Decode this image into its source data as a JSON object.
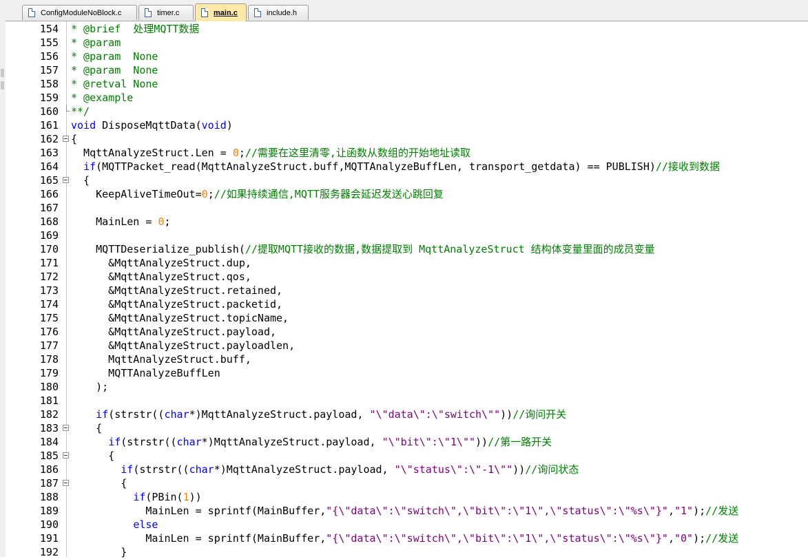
{
  "tabs": [
    {
      "label": "ConfigModuleNoBlock.c",
      "active": false,
      "icon": "c-file-icon"
    },
    {
      "label": "timer.c",
      "active": false,
      "icon": "c-file-icon"
    },
    {
      "label": "main.c",
      "active": true,
      "icon": "c-file-icon"
    },
    {
      "label": "include.h",
      "active": false,
      "icon": "header-file-icon"
    }
  ],
  "colors": {
    "keyword": "#0000ff",
    "comment": "#008000",
    "number": "#ff8000",
    "string": "#800080",
    "active_tab": "#ffe9a8"
  },
  "lines": [
    {
      "n": "154",
      "fold": "",
      "segs": [
        {
          "t": "* @brief  处理MQTT数据",
          "c": "cm"
        }
      ]
    },
    {
      "n": "155",
      "fold": "",
      "segs": [
        {
          "t": "* @param",
          "c": "cm"
        }
      ]
    },
    {
      "n": "156",
      "fold": "",
      "segs": [
        {
          "t": "* @param  None",
          "c": "cm"
        }
      ]
    },
    {
      "n": "157",
      "fold": "",
      "segs": [
        {
          "t": "* @param  None",
          "c": "cm"
        }
      ]
    },
    {
      "n": "158",
      "fold": "",
      "segs": [
        {
          "t": "* @retval None",
          "c": "cm"
        }
      ]
    },
    {
      "n": "159",
      "fold": "",
      "segs": [
        {
          "t": "* @example",
          "c": "cm"
        }
      ]
    },
    {
      "n": "160",
      "fold": "end",
      "segs": [
        {
          "t": "**/",
          "c": "cm"
        }
      ]
    },
    {
      "n": "161",
      "fold": "",
      "segs": [
        {
          "t": "void",
          "c": "kw"
        },
        {
          "t": " DisposeMqttData(",
          "c": ""
        },
        {
          "t": "void",
          "c": "kw"
        },
        {
          "t": ")",
          "c": ""
        }
      ]
    },
    {
      "n": "162",
      "fold": "box",
      "segs": [
        {
          "t": "{",
          "c": ""
        }
      ]
    },
    {
      "n": "163",
      "fold": "",
      "segs": [
        {
          "t": "  MqttAnalyzeStruct.Len = ",
          "c": ""
        },
        {
          "t": "0",
          "c": "num"
        },
        {
          "t": ";",
          "c": ""
        },
        {
          "t": "//需要在这里清零,让函数从数组的开始地址读取",
          "c": "cm"
        }
      ]
    },
    {
      "n": "164",
      "fold": "",
      "segs": [
        {
          "t": "  ",
          "c": ""
        },
        {
          "t": "if",
          "c": "kw"
        },
        {
          "t": "(MQTTPacket_read(MqttAnalyzeStruct.buff,MQTTAnalyzeBuffLen, transport_getdata) == PUBLISH)",
          "c": ""
        },
        {
          "t": "//接收到数据",
          "c": "cm"
        }
      ]
    },
    {
      "n": "165",
      "fold": "box",
      "segs": [
        {
          "t": "  {",
          "c": ""
        }
      ]
    },
    {
      "n": "166",
      "fold": "",
      "segs": [
        {
          "t": "    KeepAliveTimeOut=",
          "c": ""
        },
        {
          "t": "0",
          "c": "num"
        },
        {
          "t": ";",
          "c": ""
        },
        {
          "t": "//如果持续通信,MQTT服务器会延迟发送心跳回复",
          "c": "cm"
        }
      ]
    },
    {
      "n": "167",
      "fold": "",
      "segs": []
    },
    {
      "n": "168",
      "fold": "",
      "segs": [
        {
          "t": "    MainLen = ",
          "c": ""
        },
        {
          "t": "0",
          "c": "num"
        },
        {
          "t": ";",
          "c": ""
        }
      ]
    },
    {
      "n": "169",
      "fold": "",
      "segs": []
    },
    {
      "n": "170",
      "fold": "",
      "segs": [
        {
          "t": "    MQTTDeserialize_publish(",
          "c": ""
        },
        {
          "t": "//提取MQTT接收的数据,数据提取到 MqttAnalyzeStruct 结构体变量里面的成员变量",
          "c": "cm"
        }
      ]
    },
    {
      "n": "171",
      "fold": "",
      "segs": [
        {
          "t": "      &MqttAnalyzeStruct.dup,",
          "c": ""
        }
      ]
    },
    {
      "n": "172",
      "fold": "",
      "segs": [
        {
          "t": "      &MqttAnalyzeStruct.qos,",
          "c": ""
        }
      ]
    },
    {
      "n": "173",
      "fold": "",
      "segs": [
        {
          "t": "      &MqttAnalyzeStruct.retained,",
          "c": ""
        }
      ]
    },
    {
      "n": "174",
      "fold": "",
      "segs": [
        {
          "t": "      &MqttAnalyzeStruct.packetid,",
          "c": ""
        }
      ]
    },
    {
      "n": "175",
      "fold": "",
      "segs": [
        {
          "t": "      &MqttAnalyzeStruct.topicName,",
          "c": ""
        }
      ]
    },
    {
      "n": "176",
      "fold": "",
      "segs": [
        {
          "t": "      &MqttAnalyzeStruct.payload,",
          "c": ""
        }
      ]
    },
    {
      "n": "177",
      "fold": "",
      "segs": [
        {
          "t": "      &MqttAnalyzeStruct.payloadlen,",
          "c": ""
        }
      ]
    },
    {
      "n": "178",
      "fold": "",
      "segs": [
        {
          "t": "      MqttAnalyzeStruct.buff,",
          "c": ""
        }
      ]
    },
    {
      "n": "179",
      "fold": "",
      "segs": [
        {
          "t": "      MQTTAnalyzeBuffLen",
          "c": ""
        }
      ]
    },
    {
      "n": "180",
      "fold": "",
      "segs": [
        {
          "t": "    );",
          "c": ""
        }
      ]
    },
    {
      "n": "181",
      "fold": "",
      "segs": []
    },
    {
      "n": "182",
      "fold": "",
      "segs": [
        {
          "t": "    ",
          "c": ""
        },
        {
          "t": "if",
          "c": "kw"
        },
        {
          "t": "(strstr((",
          "c": ""
        },
        {
          "t": "char",
          "c": "kw"
        },
        {
          "t": "*)MqttAnalyzeStruct.payload, ",
          "c": ""
        },
        {
          "t": "\"\\\"data\\\":\\\"switch\\\"\"",
          "c": "str"
        },
        {
          "t": "))",
          "c": ""
        },
        {
          "t": "//询问开关",
          "c": "cm"
        }
      ]
    },
    {
      "n": "183",
      "fold": "box",
      "segs": [
        {
          "t": "    {",
          "c": ""
        }
      ]
    },
    {
      "n": "184",
      "fold": "",
      "segs": [
        {
          "t": "      ",
          "c": ""
        },
        {
          "t": "if",
          "c": "kw"
        },
        {
          "t": "(strstr((",
          "c": ""
        },
        {
          "t": "char",
          "c": "kw"
        },
        {
          "t": "*)MqttAnalyzeStruct.payload, ",
          "c": ""
        },
        {
          "t": "\"\\\"bit\\\":\\\"1\\\"\"",
          "c": "str"
        },
        {
          "t": "))",
          "c": ""
        },
        {
          "t": "//第一路开关",
          "c": "cm"
        }
      ]
    },
    {
      "n": "185",
      "fold": "box",
      "segs": [
        {
          "t": "      {",
          "c": ""
        }
      ]
    },
    {
      "n": "186",
      "fold": "",
      "segs": [
        {
          "t": "        ",
          "c": ""
        },
        {
          "t": "if",
          "c": "kw"
        },
        {
          "t": "(strstr((",
          "c": ""
        },
        {
          "t": "char",
          "c": "kw"
        },
        {
          "t": "*)MqttAnalyzeStruct.payload, ",
          "c": ""
        },
        {
          "t": "\"\\\"status\\\":\\\"-1\\\"\"",
          "c": "str"
        },
        {
          "t": "))",
          "c": ""
        },
        {
          "t": "//询问状态",
          "c": "cm"
        }
      ]
    },
    {
      "n": "187",
      "fold": "box",
      "segs": [
        {
          "t": "        {",
          "c": ""
        }
      ]
    },
    {
      "n": "188",
      "fold": "",
      "segs": [
        {
          "t": "          ",
          "c": ""
        },
        {
          "t": "if",
          "c": "kw"
        },
        {
          "t": "(PBin(",
          "c": ""
        },
        {
          "t": "1",
          "c": "num"
        },
        {
          "t": "))",
          "c": ""
        }
      ]
    },
    {
      "n": "189",
      "fold": "",
      "segs": [
        {
          "t": "            MainLen = sprintf(MainBuffer,",
          "c": ""
        },
        {
          "t": "\"{\\\"data\\\":\\\"switch\\\",\\\"bit\\\":\\\"1\\\",\\\"status\\\":\\\"%s\\\"}\"",
          "c": "str"
        },
        {
          "t": ",",
          "c": ""
        },
        {
          "t": "\"1\"",
          "c": "str"
        },
        {
          "t": ");",
          "c": ""
        },
        {
          "t": "//发送",
          "c": "cm"
        }
      ]
    },
    {
      "n": "190",
      "fold": "",
      "segs": [
        {
          "t": "          ",
          "c": ""
        },
        {
          "t": "else",
          "c": "kw"
        }
      ]
    },
    {
      "n": "191",
      "fold": "",
      "segs": [
        {
          "t": "            MainLen = sprintf(MainBuffer,",
          "c": ""
        },
        {
          "t": "\"{\\\"data\\\":\\\"switch\\\",\\\"bit\\\":\\\"1\\\",\\\"status\\\":\\\"%s\\\"}\"",
          "c": "str"
        },
        {
          "t": ",",
          "c": ""
        },
        {
          "t": "\"0\"",
          "c": "str"
        },
        {
          "t": ");",
          "c": ""
        },
        {
          "t": "//发送",
          "c": "cm"
        }
      ]
    },
    {
      "n": "192",
      "fold": "",
      "segs": [
        {
          "t": "        }",
          "c": ""
        }
      ]
    }
  ]
}
